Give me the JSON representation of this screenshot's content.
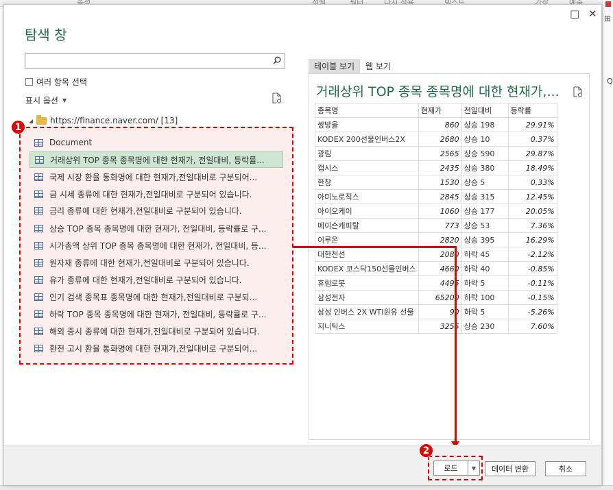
{
  "excel_background": {
    "ribbon_fragments": [
      "속성",
      "정렬",
      "필터",
      "다시 적용",
      "텍스트",
      "가상",
      "예측"
    ]
  },
  "dialog": {
    "title": "탐색 창",
    "window_controls": {
      "maximize": "□",
      "close": "✕"
    },
    "search": {
      "value": "",
      "placeholder": ""
    },
    "multi_select_label": "여러 항목 선택",
    "display_options_label": "표시 옵션",
    "tree": {
      "root_label": "https://finance.naver.com/ [13]",
      "items": [
        {
          "label": "Document",
          "selected": false
        },
        {
          "label": "거래상위 TOP 종목 종목명에 대한 현재가, 전일대비, 등락률...",
          "selected": true
        },
        {
          "label": "국제 시장 환율 통화명에 대한 현재가,전일대비로 구분되어...",
          "selected": false
        },
        {
          "label": "금 시세 종류에 대한 현재가,전일대비로 구분되어 있습니다.",
          "selected": false
        },
        {
          "label": "금리 종류에 대한 현재가,전일대비로 구분되어 있습니다.",
          "selected": false
        },
        {
          "label": "상승 TOP 종목 종목명에 대한 현재가, 전일대비, 등락률로 구...",
          "selected": false
        },
        {
          "label": "시가총액 상위 TOP 종목 종목명에 대한 현재가, 전일대비, 등...",
          "selected": false
        },
        {
          "label": "원자재 종류에 대한 현재가,전일대비로 구분되어 있습니다.",
          "selected": false
        },
        {
          "label": "유가 종류에 대한 현재가,전일대비로 구분되어 있습니다.",
          "selected": false
        },
        {
          "label": "인기 검색 종목표 종목명에 대한 현재가,전일대비로 구분되...",
          "selected": false
        },
        {
          "label": "하락 TOP 종목 종목명에 대한 현재가, 전일대비, 등락률로 구...",
          "selected": false
        },
        {
          "label": "해외 증시 종류에 대한 현재가,전일대비로 구분되어 있습니다.",
          "selected": false
        },
        {
          "label": "환전 고시 환율 통화명에 대한 현재가,전일대비로 구분되어...",
          "selected": false
        }
      ]
    },
    "preview": {
      "tabs": [
        "테이블 보기",
        "웹 보기"
      ],
      "active_tab": 0,
      "title": "거래상위 TOP 종목 종목명에 대한 현재가,...",
      "table": {
        "headers": [
          "종목명",
          "현재가",
          "전일대비",
          "등락률"
        ],
        "rows": [
          [
            "쌍방울",
            "860",
            "상승 198",
            "29.91%"
          ],
          [
            "KODEX 200선물인버스2X",
            "2680",
            "상승 10",
            "0.37%"
          ],
          [
            "광림",
            "2565",
            "상승 590",
            "29.87%"
          ],
          [
            "캡시스",
            "2435",
            "상승 380",
            "18.49%"
          ],
          [
            "한창",
            "1530",
            "상승 5",
            "0.33%"
          ],
          [
            "아미노로직스",
            "2845",
            "상승 315",
            "12.45%"
          ],
          [
            "아이오케이",
            "1060",
            "상승 177",
            "20.05%"
          ],
          [
            "메이슨캐피탈",
            "773",
            "상승 53",
            "7.36%"
          ],
          [
            "이루온",
            "2820",
            "상승 395",
            "16.29%"
          ],
          [
            "대한전선",
            "2080",
            "하락 45",
            "-2.12%"
          ],
          [
            "KODEX 코스닥150선물인버스",
            "4660",
            "하락 40",
            "-0.85%"
          ],
          [
            "휴림로봇",
            "4495",
            "하락 5",
            "-0.11%"
          ],
          [
            "삼성전자",
            "65200",
            "하락 100",
            "-0.15%"
          ],
          [
            "삼성 인버스 2X WTI원유 선물",
            "90",
            "하락 5",
            "-5.26%"
          ],
          [
            "지니틱스",
            "3255",
            "상승 230",
            "7.60%"
          ]
        ]
      }
    },
    "footer": {
      "load_label": "로드",
      "transform_label": "데이터 변환",
      "cancel_label": "취소"
    }
  },
  "annotations": {
    "badge1": "1",
    "badge2": "2",
    "color": "#e00000"
  }
}
